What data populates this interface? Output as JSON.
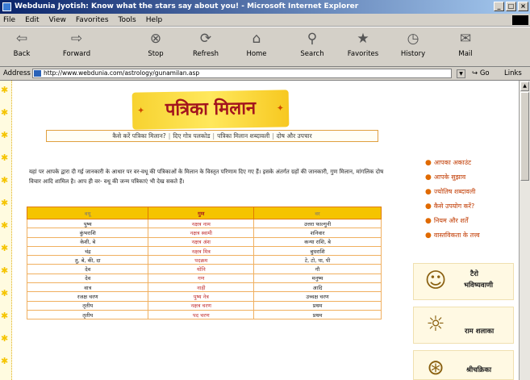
{
  "window": {
    "title": "Webdunia Jyotish: Know what the stars say about you! - Microsoft Internet Explorer"
  },
  "menu": [
    "File",
    "Edit",
    "View",
    "Favorites",
    "Tools",
    "Help"
  ],
  "toolbar": {
    "back": "Back",
    "forward": "Forward",
    "stop": "Stop",
    "refresh": "Refresh",
    "home": "Home",
    "search": "Search",
    "favorites": "Favorites",
    "history": "History",
    "mail": "Mail"
  },
  "address": {
    "label": "Address",
    "url": "http://www.webdunia.com/astrology/gunamilan.asp",
    "go": "Go",
    "links": "Links"
  },
  "page": {
    "banner_title": "पत्रिका मिलान",
    "subnav": [
      "कैसे करें पत्रिका मिलान?",
      "दिए गोत्र पलकोड",
      "पत्रिका मिलान शब्दावली",
      "दोष और उपचार"
    ],
    "intro": "यहां पर आपके द्वारा दी गई जानकारी के आधार पर वर-वधू की पत्रिकाओं के मिलान के विस्तृत परिणाम दिए गए हैं। इसके अंतर्गत ग्रहों की जानकारी, गुण मिलान, मांगलिक दोष विचार आदि शामिल है। आप ही वर- वधू की जन्म पत्रिकाएं भी देख सकते हैं।",
    "table": {
      "headers": [
        "वधू",
        "गुण",
        "वर"
      ],
      "rows": [
        [
          "पुष्य",
          "नक्षत्र नाम",
          "उत्तरा फाल्गुनी"
        ],
        [
          "कुंभराशि",
          "नक्षत्र स्वामी",
          "शनिवार"
        ],
        [
          "केशी, बे",
          "नक्षत्र अंश",
          "कन्या राशि, बे"
        ],
        [
          "चंद्र",
          "नक्षत्र मित्र",
          "बुधराशि"
        ],
        [
          "तु, बे, की, दा",
          "पदक्रम",
          "टे, टो, पा, पी"
        ],
        [
          "देव",
          "योनि",
          "गौ"
        ],
        [
          "देव",
          "गण",
          "मनुष्य"
        ],
        [
          "वात्र",
          "नाड़ी",
          "आदि"
        ],
        [
          "रजक्ष चरण",
          "पुष्य नेत्र",
          "उच्चक्ष चरण"
        ],
        [
          "तृतीय",
          "नक्षत्र चरण",
          "प्रथम"
        ],
        [
          "तृतीय",
          "पद चरण",
          "प्रथम"
        ]
      ]
    },
    "sidebar_links": [
      "आपका अकाउंट",
      "आपके सुझाव",
      "ज्योतिष शब्दावली",
      "कैसे उपयोग करें?",
      "नियम और शर्तें",
      "वास्तविकता के तत्त्व"
    ],
    "promos": [
      {
        "line1": "टैरो",
        "line2": "भविष्यवाणी",
        "icon": "tarot-card-icon"
      },
      {
        "line1": "राम शलाका",
        "icon": "sage-icon"
      },
      {
        "line1": "श्रीचक्रिका",
        "icon": "zodiac-wheel-icon"
      }
    ]
  },
  "colors": {
    "accent_yellow": "#f5c400",
    "accent_red": "#a3141e",
    "link_orange": "#c03a00"
  }
}
